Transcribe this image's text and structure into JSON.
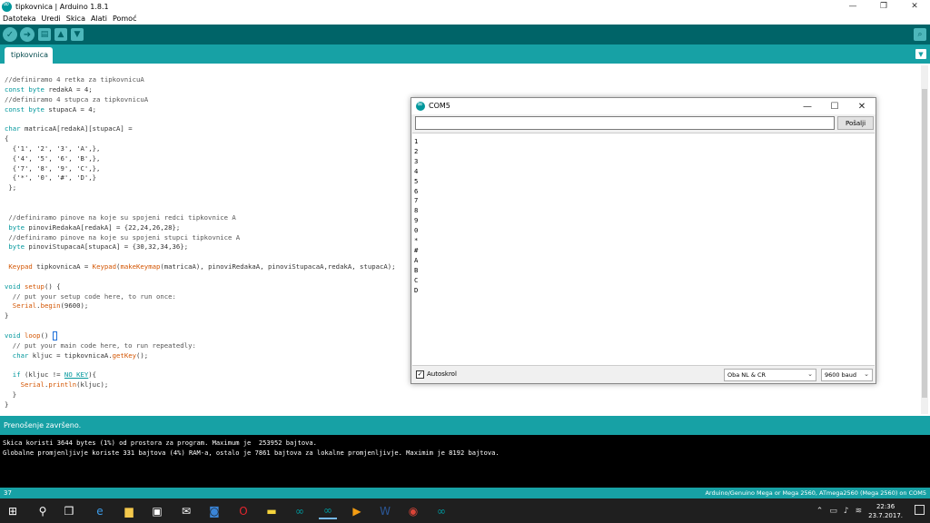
{
  "window": {
    "title": "tipkovnica | Arduino 1.8.1",
    "minimize": "—",
    "maximize": "❐",
    "close": "✕"
  },
  "menu": [
    "Datoteka",
    "Uredi",
    "Skica",
    "Alati",
    "Pomoć"
  ],
  "toolbar": {
    "verify": "✓",
    "upload": "➜",
    "new": "▤",
    "open": "▲",
    "save": "▼",
    "serial_monitor": "⌕"
  },
  "tab": {
    "name": "tipkovnica",
    "menu": "▼"
  },
  "code": [
    "//definiramo 4 retka za tipkovnicuA",
    "const byte redakA = 4;",
    "//definiramo 4 stupca za tipkovnicuA",
    "const byte stupacA = 4;",
    "",
    "char matricaA[redakA][stupacA] =",
    "{",
    "  {'1', '2', '3', 'A',},",
    "  {'4', '5', '6', 'B',},",
    "  {'7', '8', '9', 'C',},",
    "  {'*', '0', '#', 'D',}",
    " };",
    "",
    "",
    " //definiramo pinove na koje su spojeni redci tipkovnice A",
    " byte pinoviRedakaA[redakA] = {22,24,26,28};",
    " //definiramo pinove na koje su spojeni stupci tipkovnice A",
    " byte pinoviStupacaA[stupacA] = {30,32,34,36};",
    "",
    " Keypad tipkovnicaA = Keypad(makeKeymap(matricaA), pinoviRedakaA, pinoviStupacaA,redakA, stupacA);",
    "",
    "void setup() {",
    "  // put your setup code here, to run once:",
    "  Serial.begin(9600);",
    "}",
    "",
    "void loop() {",
    "  // put your main code here, to run repeatedly:",
    "  char kljuc = tipkovnicaA.getKey();",
    "",
    "  if (kljuc != NO_KEY){",
    "    Serial.println(kljuc);",
    "  }",
    "}"
  ],
  "status": {
    "message": "Prenošenje završeno."
  },
  "console": [
    "Skica koristi 3644 bytes (1%) od prostora za program. Maximum je  253952 bajtova.",
    "Globalne promjenljivje koriste 331 bajtova (4%) RAM-a, ostalo je 7861 bajtova za lokalne promjenljivje. Maximim je 8192 bajtova."
  ],
  "footer": {
    "line": "37",
    "board": "Arduino/Genuino Mega or Mega 2560, ATmega2560 (Mega 2560) on COM5"
  },
  "serial_monitor": {
    "title": "COM5",
    "input_value": "",
    "send_label": "Pošalji",
    "output": [
      "1",
      "2",
      "3",
      "4",
      "5",
      "6",
      "7",
      "8",
      "9",
      "0",
      "*",
      "#",
      "A",
      "B",
      "C",
      "D"
    ],
    "autoscroll_label": "Autoskrol",
    "autoscroll_checked": "✓",
    "line_ending": "Oba NL & CR",
    "baud": "9600 baud",
    "dropdown_arrow": "⌄"
  },
  "taskbar": {
    "start": "⊞",
    "search": "⚲",
    "taskview": "❒",
    "apps": [
      "e",
      "▆",
      "▣",
      "✉",
      "◙",
      "O",
      "▬",
      "∞",
      "∞",
      "▶",
      "W",
      "◉",
      "∞"
    ],
    "tray": [
      "⌃",
      "▭",
      "♪",
      "≋"
    ],
    "time": "22:36",
    "date": "23.7.2017."
  }
}
